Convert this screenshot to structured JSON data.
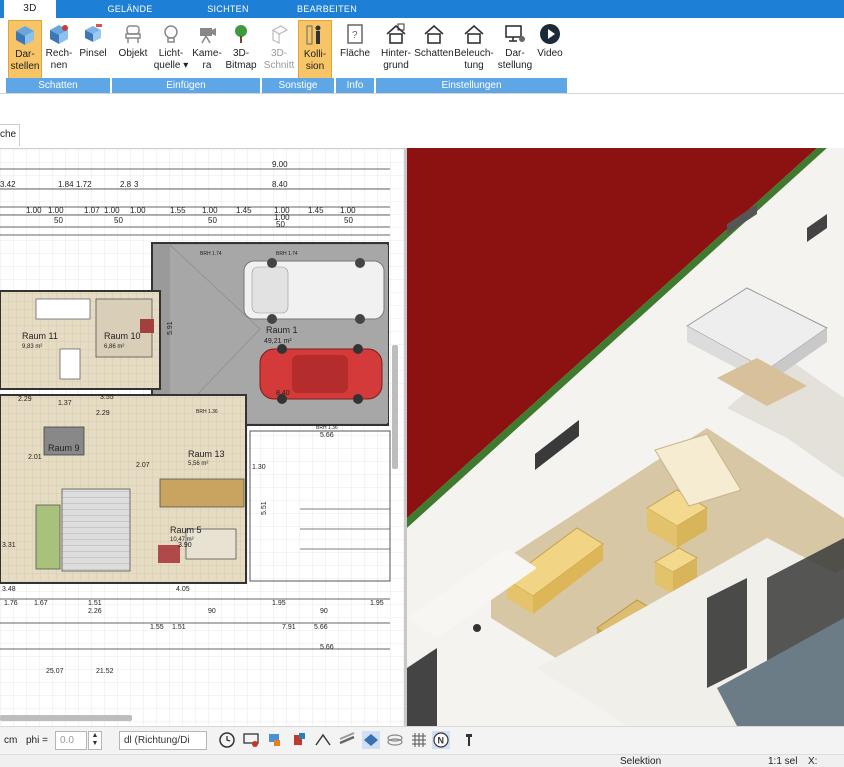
{
  "tabs": [
    {
      "label": "3D",
      "active": true
    },
    {
      "label": "GELÄNDE"
    },
    {
      "label": "SICHTEN"
    },
    {
      "label": "BEARBEITEN"
    }
  ],
  "ribbon": {
    "buttons": {
      "darstellen": {
        "line1": "Dar-",
        "line2": "stellen",
        "selected": true,
        "icon": "cube-icon"
      },
      "rechnen": {
        "line1": "Rech-",
        "line2": "nen",
        "icon": "cube-icon"
      },
      "pinsel": {
        "line1": "Pinsel",
        "line2": "",
        "icon": "paint-icon"
      },
      "objekt": {
        "line1": "Objekt",
        "line2": "",
        "icon": "chair-icon"
      },
      "lichtquelle": {
        "line1": "Licht-",
        "line2": "quelle ▾",
        "icon": "bulb-icon"
      },
      "kamera": {
        "line1": "Kame-",
        "line2": "ra",
        "icon": "camera-icon"
      },
      "bitmap": {
        "line1": "3D-",
        "line2": "Bitmap",
        "icon": "tree-icon"
      },
      "schnitt": {
        "line1": "3D-",
        "line2": "Schnitt",
        "disabled": true,
        "icon": "cut-icon"
      },
      "kollision": {
        "line1": "Kolli-",
        "line2": "sion",
        "selected": true,
        "icon": "person-icon"
      },
      "flaeche": {
        "line1": "Fläche",
        "line2": "",
        "icon": "area-icon"
      },
      "hintergrund": {
        "line1": "Hinter-",
        "line2": "grund",
        "icon": "house-icon"
      },
      "schatten": {
        "line1": "Schatten",
        "line2": "",
        "icon": "house-icon"
      },
      "beleuchtung": {
        "line1": "Beleuch-",
        "line2": "tung",
        "icon": "house-icon"
      },
      "darstellung": {
        "line1": "Dar-",
        "line2": "stellung",
        "icon": "monitor-icon"
      },
      "video": {
        "line1": "Video",
        "line2": "",
        "icon": "play-icon"
      }
    },
    "groups": {
      "schatten": "Schatten",
      "einfuegen": "Einfügen",
      "sonstige": "Sonstige",
      "info": "Info",
      "einstellungen": "Einstellungen"
    },
    "accent": "#1e7fd6",
    "group_color": "#5ea6e6",
    "selected_color": "#f7c567"
  },
  "subtab_label": "che",
  "plan": {
    "dims_top": [
      "9.00",
      "8.40",
      "3.42",
      "1.84",
      "1.72",
      "2.8",
      "3",
      "1.00",
      "1.00",
      "1.07",
      "1.00",
      "1.00",
      "1.55",
      "1.00",
      "1.45",
      "1.00",
      "1.00",
      "1.45",
      "1.00",
      "50",
      "50",
      "50",
      "50",
      "50"
    ],
    "rooms": [
      {
        "name": "Raum 1",
        "area": "49,21 m²"
      },
      {
        "name": "Raum 11",
        "area": "9,83 m²"
      },
      {
        "name": "Raum 10",
        "area": "6,86 m²"
      },
      {
        "name": "Raum 9",
        "area": ""
      },
      {
        "name": "Raum 13",
        "area": "5,56 m²"
      },
      {
        "name": "Raum 5",
        "area": "10,47 m²"
      }
    ],
    "dims_other": [
      "5.91",
      "8.40",
      "5.66",
      "2.29",
      "1.37",
      "3.55",
      "2.29",
      "2.07",
      "1.30",
      "5.51",
      "3.31",
      "2.01",
      "3.90",
      "4.05",
      "3.48",
      "1.76",
      "1.67",
      "1.51",
      "2.26",
      "1.55",
      "1.51",
      "7.91",
      "5.66",
      "25.07",
      "21.52",
      "5.66",
      "1.95",
      "1.95",
      "90",
      "90"
    ],
    "labels_brh": [
      "BRH 1.74",
      "BRH 1.74",
      "BRH 1.36",
      "BRH 1.36"
    ]
  },
  "bottom": {
    "unit": "cm",
    "phi_label": "phi =",
    "phi_value": "0.0",
    "mode_value": "dl (Richtung/Di",
    "icons": [
      "clock-icon",
      "monitor-icon",
      "paint-icon",
      "bucket-icon",
      "line-icon",
      "fence-icon",
      "layer-icon",
      "stack-icon",
      "grid-icon",
      "north-icon",
      "pin-icon"
    ]
  },
  "status": {
    "selektion": "Selektion",
    "scale": "1:1 sel",
    "coord_x": "X:"
  }
}
